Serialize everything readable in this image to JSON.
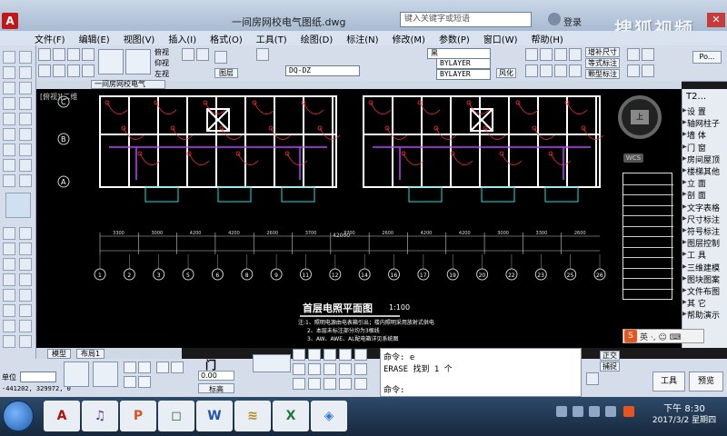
{
  "app": {
    "logo": "A",
    "title": "一间房网校电气图纸.dwg",
    "search_placeholder": "键入关键字或短语",
    "login": "登录",
    "watermark": "搜狐视频",
    "close": "✕"
  },
  "menu": [
    "文件(F)",
    "编辑(E)",
    "视图(V)",
    "插入(I)",
    "格式(O)",
    "工具(T)",
    "绘图(D)",
    "标注(N)",
    "修改(M)",
    "参数(P)",
    "窗口(W)",
    "帮助(H)"
  ],
  "ribbon": {
    "view_options": [
      "俯视",
      "仰视",
      "左视"
    ],
    "layer_combo": "DQ-DZ",
    "linetype_combo": "BYLAYER",
    "lineweight_combo": "BYLAYER",
    "color_combo": "黑",
    "tag_buttons": [
      "增补尺寸",
      "等式标注",
      "颗型标注"
    ],
    "layer_button": "图层",
    "mode_button": "风化",
    "po_button": "Po..."
  },
  "drawing_tab": "一间房网校电气",
  "canvas": {
    "label": "[俯视][二维",
    "plan_title": "首层电照平面图",
    "plan_scale": "1:100",
    "notes": [
      "注:1、照明电源由电表箱引出；楼内照明采用放射式供电",
      "2、本层未标注部分均为3根线",
      "3、AW、AWE、AL配电箱详见系统图"
    ],
    "dimensions": [
      "3300",
      "3000",
      "4200",
      "4200",
      "2600",
      "3700",
      "3700",
      "2600",
      "4200",
      "4200",
      "3000",
      "3300",
      "2600"
    ],
    "total_dimension": "42000",
    "axes": [
      "1",
      "2",
      "3",
      "5",
      "6",
      "8",
      "9",
      "11",
      "12",
      "14",
      "16",
      "17",
      "19",
      "20",
      "22",
      "23",
      "25",
      "26"
    ],
    "row_axes": [
      "C",
      "B",
      "A"
    ],
    "compass_face": "上",
    "wcs": "WCS"
  },
  "rightpanel": {
    "title": "T2...",
    "items": [
      "设    置",
      "轴网柱子",
      "墙    体",
      "门    窗",
      "房间屋顶",
      "楼梯其他",
      "立    面",
      "剖    面",
      "文字表格",
      "尺寸标注",
      "符号标注",
      "图层控制",
      "工    具",
      "三维建模",
      "图块图案",
      "文件布图",
      "其    它",
      "帮助演示"
    ]
  },
  "layout_tabs": [
    "模型",
    "布局1"
  ],
  "bottom": {
    "unit": "单位",
    "coordinates": "-441202, 329972, 0",
    "scale_value": "0.00",
    "scale_label": "标高",
    "door_label": "门",
    "mode_buttons": [
      "正交",
      "捕捉"
    ],
    "tools": "工具",
    "preview": "预览"
  },
  "command": {
    "lines": [
      "命令: e",
      "ERASE 找到 1 个",
      "",
      "命令:"
    ]
  },
  "ime": {
    "logo": "S",
    "mode": "英 ·, ☺ ⌨"
  },
  "taskbar": {
    "apps": [
      "A",
      "♫",
      "P",
      "◻",
      "W",
      "≋",
      "X",
      "◈"
    ],
    "time": "下午 8:30",
    "date": "2017/3/2 星期四"
  },
  "colors": {
    "wall": "#ffffff",
    "wire": "#ff3030",
    "purple": "#c040ff",
    "cyan": "#20e0e0"
  }
}
